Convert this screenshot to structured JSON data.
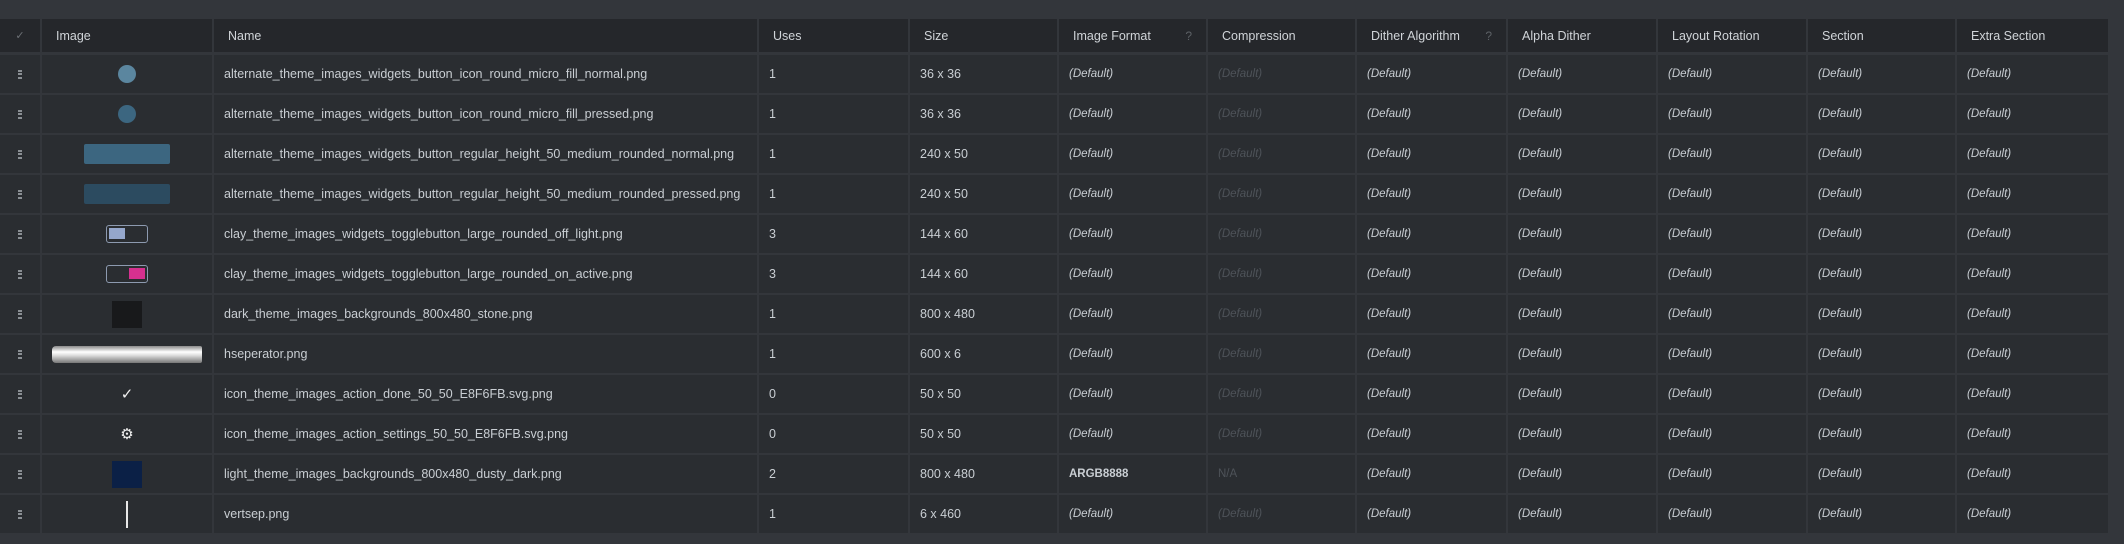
{
  "header": {
    "check": "✓",
    "image": "Image",
    "name": "Name",
    "uses": "Uses",
    "size": "Size",
    "image_format": "Image Format",
    "compression": "Compression",
    "dither_algorithm": "Dither Algorithm",
    "alpha_dither": "Alpha Dither",
    "layout_rotation": "Layout Rotation",
    "section": "Section",
    "extra_section": "Extra Section",
    "help": "?"
  },
  "rows": [
    {
      "thumb": "circle",
      "color": "#5b869f",
      "name": "alternate_theme_images_widgets_button_icon_round_micro_fill_normal.png",
      "uses": "1",
      "size": "36 x 36",
      "format": "(Default)",
      "compression": "(Default)",
      "dither": "(Default)",
      "alpha": "(Default)",
      "rotation": "(Default)",
      "section": "(Default)",
      "extra": "(Default)"
    },
    {
      "thumb": "circle",
      "color": "#3c6680",
      "name": "alternate_theme_images_widgets_button_icon_round_micro_fill_pressed.png",
      "uses": "1",
      "size": "36 x 36",
      "format": "(Default)",
      "compression": "(Default)",
      "dither": "(Default)",
      "alpha": "(Default)",
      "rotation": "(Default)",
      "section": "(Default)",
      "extra": "(Default)"
    },
    {
      "thumb": "rect",
      "color": "#3c6680",
      "name": "alternate_theme_images_widgets_button_regular_height_50_medium_rounded_normal.png",
      "uses": "1",
      "size": "240 x 50",
      "format": "(Default)",
      "compression": "(Default)",
      "dither": "(Default)",
      "alpha": "(Default)",
      "rotation": "(Default)",
      "section": "(Default)",
      "extra": "(Default)"
    },
    {
      "thumb": "rect",
      "color": "#2c4b60",
      "name": "alternate_theme_images_widgets_button_regular_height_50_medium_rounded_pressed.png",
      "uses": "1",
      "size": "240 x 50",
      "format": "(Default)",
      "compression": "(Default)",
      "dither": "(Default)",
      "alpha": "(Default)",
      "rotation": "(Default)",
      "section": "(Default)",
      "extra": "(Default)"
    },
    {
      "thumb": "toggle-off",
      "color": "#95a7cc",
      "name": "clay_theme_images_widgets_togglebutton_large_rounded_off_light.png",
      "uses": "3",
      "size": "144 x 60",
      "format": "(Default)",
      "compression": "(Default)",
      "dither": "(Default)",
      "alpha": "(Default)",
      "rotation": "(Default)",
      "section": "(Default)",
      "extra": "(Default)"
    },
    {
      "thumb": "toggle-on",
      "color": "#d6308f",
      "name": "clay_theme_images_widgets_togglebutton_large_rounded_on_active.png",
      "uses": "3",
      "size": "144 x 60",
      "format": "(Default)",
      "compression": "(Default)",
      "dither": "(Default)",
      "alpha": "(Default)",
      "rotation": "(Default)",
      "section": "(Default)",
      "extra": "(Default)"
    },
    {
      "thumb": "dark",
      "color": "#18191b",
      "name": "dark_theme_images_backgrounds_800x480_stone.png",
      "uses": "1",
      "size": "800 x 480",
      "format": "(Default)",
      "compression": "(Default)",
      "dither": "(Default)",
      "alpha": "(Default)",
      "rotation": "(Default)",
      "section": "(Default)",
      "extra": "(Default)"
    },
    {
      "thumb": "hsep",
      "color": "#dddddd",
      "name": "hseperator.png",
      "uses": "1",
      "size": "600 x 6",
      "format": "(Default)",
      "compression": "(Default)",
      "dither": "(Default)",
      "alpha": "(Default)",
      "rotation": "(Default)",
      "section": "(Default)",
      "extra": "(Default)"
    },
    {
      "thumb": "check",
      "color": "#e8f6fb",
      "name": "icon_theme_images_action_done_50_50_E8F6FB.svg.png",
      "uses": "0",
      "size": "50 x 50",
      "format": "(Default)",
      "compression": "(Default)",
      "dither": "(Default)",
      "alpha": "(Default)",
      "rotation": "(Default)",
      "section": "(Default)",
      "extra": "(Default)"
    },
    {
      "thumb": "gear",
      "color": "#e8f6fb",
      "name": "icon_theme_images_action_settings_50_50_E8F6FB.svg.png",
      "uses": "0",
      "size": "50 x 50",
      "format": "(Default)",
      "compression": "(Default)",
      "dither": "(Default)",
      "alpha": "(Default)",
      "rotation": "(Default)",
      "section": "(Default)",
      "extra": "(Default)"
    },
    {
      "thumb": "dark",
      "color": "#0b2046",
      "name": "light_theme_images_backgrounds_800x480_dusty_dark.png",
      "uses": "2",
      "size": "800 x 480",
      "format": "ARGB8888",
      "compression": "N/A",
      "dither": "(Default)",
      "alpha": "(Default)",
      "rotation": "(Default)",
      "section": "(Default)",
      "extra": "(Default)"
    },
    {
      "thumb": "vline",
      "color": "#e8e8e8",
      "name": "vertsep.png",
      "uses": "1",
      "size": "6 x 460",
      "format": "(Default)",
      "compression": "(Default)",
      "dither": "(Default)",
      "alpha": "(Default)",
      "rotation": "(Default)",
      "section": "(Default)",
      "extra": "(Default)"
    }
  ]
}
